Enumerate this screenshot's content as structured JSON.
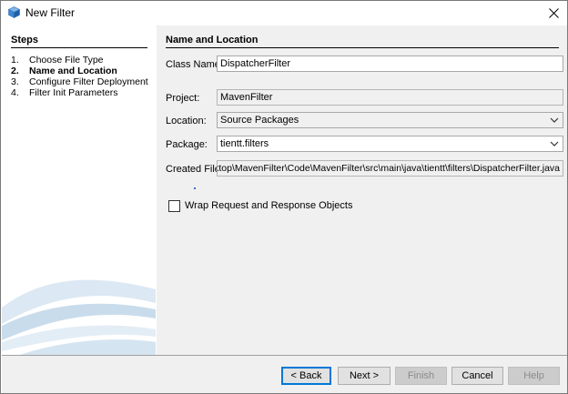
{
  "window": {
    "title": "New Filter",
    "icon": "netbeans-cube-icon",
    "close": "close-icon"
  },
  "steps": {
    "heading": "Steps",
    "items": [
      {
        "num": "1.",
        "label": "Choose File Type"
      },
      {
        "num": "2.",
        "label": "Name and Location"
      },
      {
        "num": "3.",
        "label": "Configure Filter Deployment"
      },
      {
        "num": "4.",
        "label": "Filter Init Parameters"
      }
    ]
  },
  "content": {
    "section_title": "Name and Location",
    "class_name_label": "Class Name:",
    "class_name_value": "DispatcherFilter",
    "project_label": "Project:",
    "project_value": "MavenFilter",
    "location_label": "Location:",
    "location_value": "Source Packages",
    "package_label": "Package:",
    "package_value": "tientt.filters",
    "created_file_label": "Created File:",
    "created_file_value": "\\Desktop\\MavenFilter\\Code\\MavenFilter\\src\\main\\java\\tientt\\filters\\DispatcherFilter.java",
    "wrap_checkbox_label": "Wrap Request and Response Objects"
  },
  "buttons": {
    "back": "< Back",
    "next": "Next >",
    "finish": "Finish",
    "cancel": "Cancel",
    "help": "Help"
  },
  "colors": {
    "content_bg": "#f0f0f0",
    "default_button_border": "#0078d7",
    "swoosh": "#c9dcec"
  }
}
